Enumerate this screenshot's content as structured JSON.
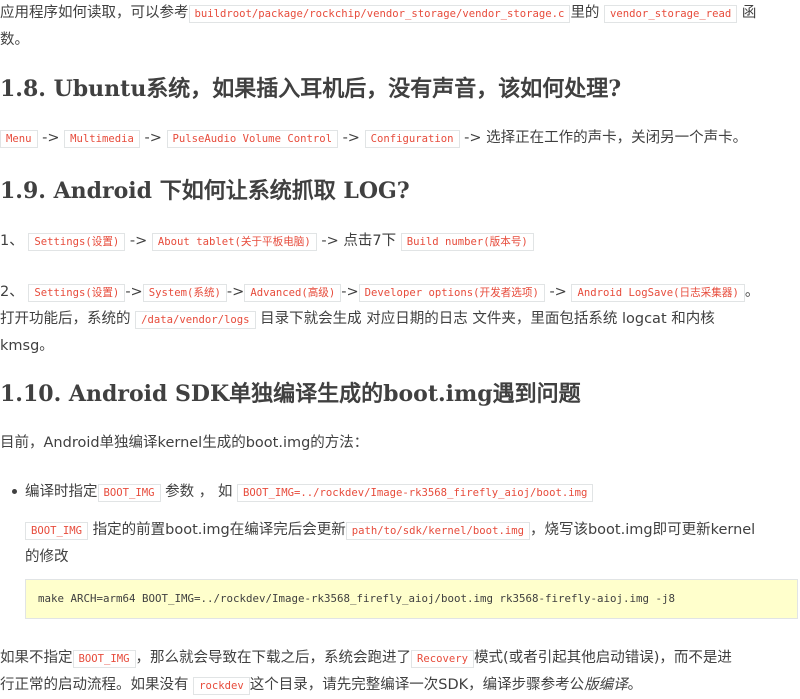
{
  "intro": {
    "text1": "应用程序如何读取，可以参考",
    "code1": "buildroot/package/rockchip/vendor_storage/vendor_storage.c",
    "text2": "里的",
    "code2": "vendor_storage_read",
    "text3": "函",
    "text4": "数。"
  },
  "section_1_8": {
    "heading": "1.8. Ubuntu系统，如果插入耳机后，没有声音，该如何处理?",
    "steps": [
      "Menu",
      "Multimedia",
      "PulseAudio Volume Control",
      "Configuration"
    ],
    "arrow": "->",
    "tail": "选择正在工作的声卡，关闭另一个声卡。"
  },
  "section_1_9": {
    "heading": "1.9. Android 下如何让系统抓取 LOG?",
    "item1": {
      "num": "1、",
      "code1": "Settings(设置)",
      "arrow": "->",
      "code2": "About tablet(关于平板电脑)",
      "text": "-> 点击7下",
      "code3": "Build number(版本号)"
    },
    "item2": {
      "num": "2、",
      "codes": [
        "Settings(设置)",
        "System(系统)",
        "Advanced(高级)",
        "Developer options(开发者选项)",
        "Android LogSave(日志采集器)"
      ],
      "arrow": "->",
      "end": "。",
      "line2_a": "打开功能后，系统的",
      "line2_code": "/data/vendor/logs",
      "line2_b": "目录下就会生成 对应日期的日志 文件夹，里面包括系统 logcat 和内核",
      "line3": "kmsg。"
    }
  },
  "section_1_10": {
    "heading": "1.10. Android SDK单独编译生成的boot.img遇到问题",
    "intro": "目前，Android单独编译kernel生成的boot.img的方法：",
    "bullet": {
      "t1": "编译时指定",
      "c1": "BOOT_IMG",
      "t2": "参数 ，  如",
      "c2": "BOOT_IMG=../rockdev/Image-rk3568_firefly_aioj/boot.img"
    },
    "note": {
      "c1": "BOOT_IMG",
      "t1": "指定的前置boot.img在编译完后会更新",
      "c2": "path/to/sdk/kernel/boot.img",
      "t2": "，烧写该boot.img即可更新kernel",
      "t3": "的修改"
    },
    "command": "make ARCH=arm64 BOOT_IMG=../rockdev/Image-rk3568_firefly_aioj/boot.img rk3568-firefly-aioj.img -j8",
    "outro": {
      "t1": "如果不指定",
      "c1": "BOOT_IMG",
      "t2": "，那么就会导致在下载之后，系统会跑进了",
      "c2": "Recovery",
      "t3": "模式(或者引起其他启动错误)，而不是进",
      "t4": "行正常的启动流程。如果没有",
      "c3": "rockdev",
      "t5": "这个目录，请先完整编译一次SDK，编译步骤参考公",
      "t6": "版编译",
      "t7": "。"
    }
  }
}
